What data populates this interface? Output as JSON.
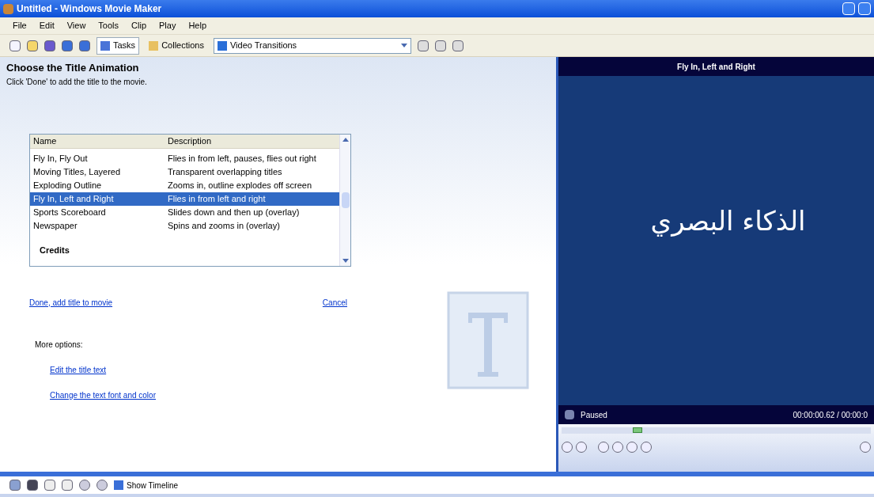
{
  "window": {
    "title": "Untitled - Windows Movie Maker"
  },
  "menu": [
    "File",
    "Edit",
    "View",
    "Tools",
    "Clip",
    "Play",
    "Help"
  ],
  "toolbar": {
    "tasks": {
      "label": "Tasks",
      "selected": true
    },
    "collections": {
      "label": "Collections",
      "selected": false
    },
    "dropdown": "Video Transitions"
  },
  "task": {
    "heading": "Choose the Title Animation",
    "instruction": "Click 'Done' to add the title to the movie.",
    "columns": [
      "Name",
      "Description"
    ],
    "rows": [
      {
        "kind": "item",
        "name": "Fly In, Fly Out",
        "description": "Flies in from left, pauses, flies out right",
        "selected": false
      },
      {
        "kind": "item",
        "name": "Moving Titles, Layered",
        "description": "Transparent overlapping titles",
        "selected": false
      },
      {
        "kind": "item",
        "name": "Exploding Outline",
        "description": "Zooms in, outline explodes off screen",
        "selected": false
      },
      {
        "kind": "item",
        "name": "Fly In, Left and Right",
        "description": "Flies in from left and right",
        "selected": true
      },
      {
        "kind": "item",
        "name": "Sports Scoreboard",
        "description": "Slides down and then up (overlay)",
        "selected": false
      },
      {
        "kind": "item",
        "name": "Newspaper",
        "description": "Spins and zooms in (overlay)",
        "selected": false
      },
      {
        "kind": "group",
        "name": "Credits"
      }
    ],
    "done": "Done, add title to movie",
    "cancel": "Cancel",
    "more": "More options:",
    "options": [
      "Edit the title text",
      "Change the text font and color"
    ]
  },
  "preview": {
    "title": "Fly In, Left and Right",
    "text": "الذكاء البصري",
    "status": "Paused",
    "time": "00:00:00.62 / 00:00:0",
    "seek": {
      "level": 0.23
    }
  },
  "bottom": {
    "show_timeline": "Show Timeline"
  }
}
